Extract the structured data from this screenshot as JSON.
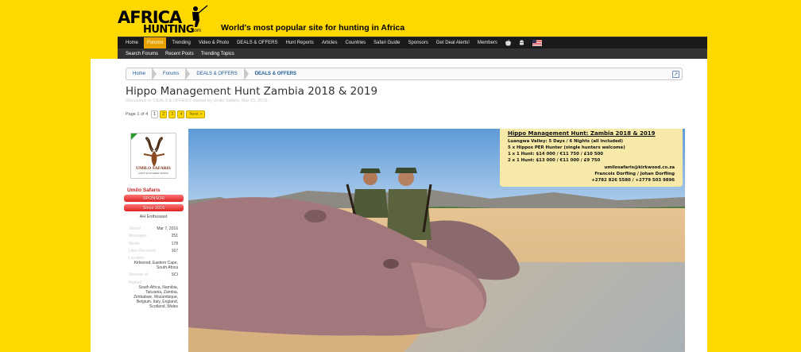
{
  "logo": {
    "main": "AFRICA",
    "sub": "HUNTING",
    "suffix": ".com"
  },
  "tagline": "World's most popular site for hunting in Africa",
  "nav": {
    "items": [
      "Home",
      "Forums",
      "Trending",
      "Video & Photo",
      "DEALS & OFFERS",
      "Hunt Reports",
      "Articles",
      "Countries",
      "Safari Guide",
      "Sponsors",
      "Get Deal Alerts!",
      "Members"
    ],
    "active": "Forums",
    "icons": [
      "apple-icon",
      "android-icon",
      "us-flag-icon"
    ]
  },
  "subnav": {
    "items": [
      "Search Forums",
      "Recent Posts",
      "Trending Topics"
    ]
  },
  "breadcrumb": {
    "items": [
      "Home",
      "Forums",
      "DEALS & OFFERS",
      "DEALS & OFFERS"
    ],
    "jump": "↗"
  },
  "thread": {
    "title": "Hippo Management Hunt Zambia 2018 & 2019",
    "meta": "Discussion in 'DEALS & OFFERS' started by Umilo Safaris, Mar 25, 2018."
  },
  "pagination": {
    "label": "Page 1 of 4",
    "pages": [
      "1",
      "2",
      "3",
      "4"
    ],
    "current": "1",
    "next": "Next >"
  },
  "user": {
    "avatar_brand": "UMILO SAFARIS",
    "avatar_sub": "HUNT SOUTHERN AFRICA",
    "name": "Umilo Safaris",
    "badge1": "SPONSOR",
    "badge2": "Since 2016",
    "role": "AH Enthusiast",
    "stats": [
      {
        "k": "Joined",
        "v": "Mar 7, 2016"
      },
      {
        "k": "Messages",
        "v": "251"
      },
      {
        "k": "Media",
        "v": "178"
      },
      {
        "k": "Likes Received",
        "v": "167"
      },
      {
        "k": "Location",
        "v": "Kirkwood, Eastern Cape, South Africa"
      },
      {
        "k": "Member of",
        "v": "SCI"
      },
      {
        "k": "Hunted",
        "v": "South Africa, Namibia, Tanzania, Zambia, Zimbabwe, Mozambique, Belgium, Italy, England, Scotland, Wales"
      }
    ]
  },
  "overlay": {
    "title": "Hippo Management Hunt: Zambia 2018 & 2019",
    "lines": [
      "Luangwa Valley:  5 Days / 6 Nights (all included)",
      "5 x Hippos PER Hunter (single hunters welcome)",
      "1 x 1 Hunt:  $14 000 / €11 750 / £10 500",
      "2 x 1 Hunt:  $13 000 / €11 000 / £9 750"
    ],
    "email": "umilosafaris@kirkwood.co.za",
    "contacts": "Francois Dorfling / Johan Dorfling",
    "phones": "+2782 826 5580 / +2779 503 9896"
  },
  "colors": {
    "page_bg": "#ffd800",
    "nav_bg": "#1a1a1a",
    "nav_active": "#e8a200",
    "badge": "#d22",
    "link": "#1d5a94"
  }
}
